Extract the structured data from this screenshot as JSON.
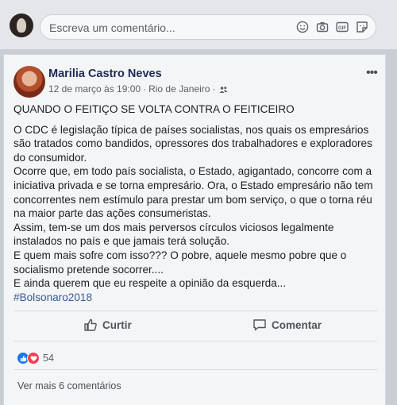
{
  "comment_bar": {
    "placeholder": "Escreva um comentário...",
    "icons": [
      "smiley-icon",
      "camera-icon",
      "gif-icon",
      "sticker-icon"
    ],
    "gif_label": "GIF"
  },
  "post": {
    "author": "Marilia Castro Neves",
    "date": "12 de março às 19:00",
    "separator": "·",
    "location": "Rio de Janeiro",
    "privacy_icon": "friends-icon",
    "menu_icon": "more-icon",
    "menu_label": "•••",
    "lines": [
      "QUANDO O FEITIÇO SE VOLTA CONTRA O FEITICEIRO",
      "",
      "O CDC é legislação típica de países socialistas, nos quais os empresários",
      "são tratados como bandidos, opressores dos trabalhadores e exploradores",
      "do consumidor.",
      "Ocorre que, em todo país socialista, o Estado, agigantado, concorre com a",
      "iniciativa privada e se torna empresário. Ora, o Estado empresário não tem",
      "concorrentes nem estímulo para prestar um bom serviço, o que o torna réu",
      "na maior parte das ações consumeristas.",
      "Assim, tem-se um dos mais perversos círculos viciosos legalmente",
      "instalados no país e que jamais terá solução.",
      "E quem mais sofre com isso??? O pobre, aquele mesmo pobre que o",
      "socialismo pretende socorrer....",
      "E ainda querem que eu respeite a opinião da esquerda..."
    ],
    "hashtag": "#Bolsonaro2018"
  },
  "actions": {
    "like_label": "Curtir",
    "comment_label": "Comentar"
  },
  "reactions": {
    "icons": [
      "like-reaction-icon",
      "love-reaction-icon"
    ],
    "colors": {
      "like": "#1877f2",
      "love": "#f33e58"
    },
    "count": "54"
  },
  "comments": {
    "view_more": "Ver mais 6 comentários"
  }
}
